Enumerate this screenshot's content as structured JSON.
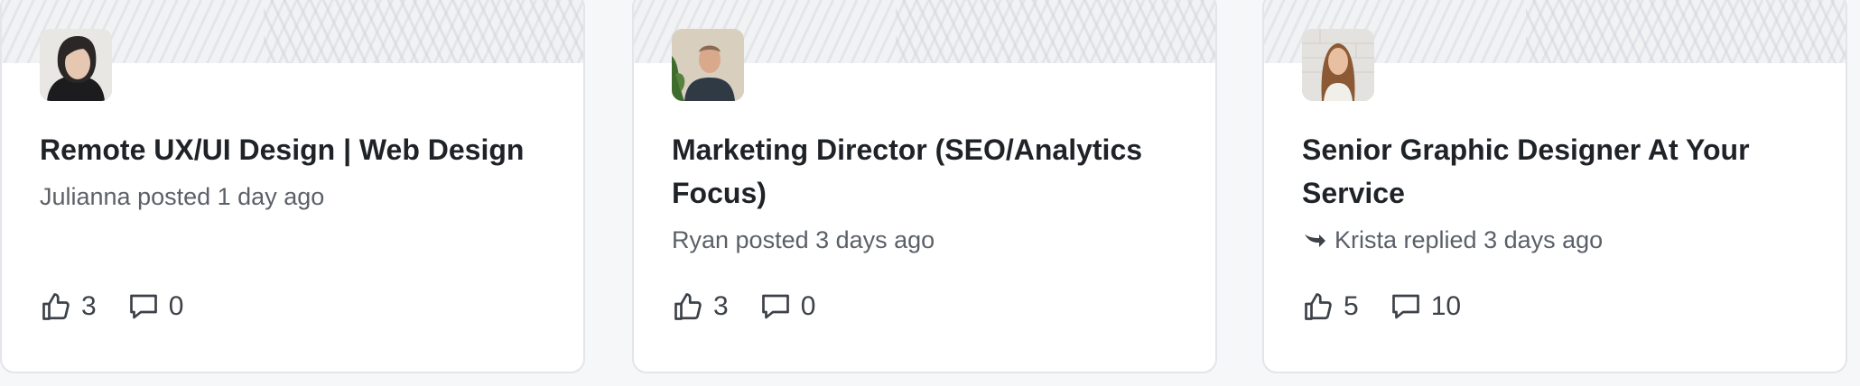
{
  "cards": [
    {
      "title": "Remote UX/UI Design | Web Design",
      "meta": "Julianna posted 1 day ago",
      "likes": "3",
      "comments": "0",
      "reply_indicator": false
    },
    {
      "title": "Marketing Director (SEO/Analytics Focus)",
      "meta": "Ryan posted 3 days ago",
      "likes": "3",
      "comments": "0",
      "reply_indicator": false
    },
    {
      "title": "Senior Graphic Designer At Your Service",
      "meta": "Krista replied 3 days ago",
      "likes": "5",
      "comments": "10",
      "reply_indicator": true
    }
  ],
  "icons": {
    "like": "thumbs-up-icon",
    "comment": "comment-icon",
    "reply": "reply-arrow-icon"
  },
  "colors": {
    "card_background": "#ffffff",
    "page_background": "#f6f7f9",
    "title_text": "#1f2328",
    "meta_text": "#5b6068"
  }
}
